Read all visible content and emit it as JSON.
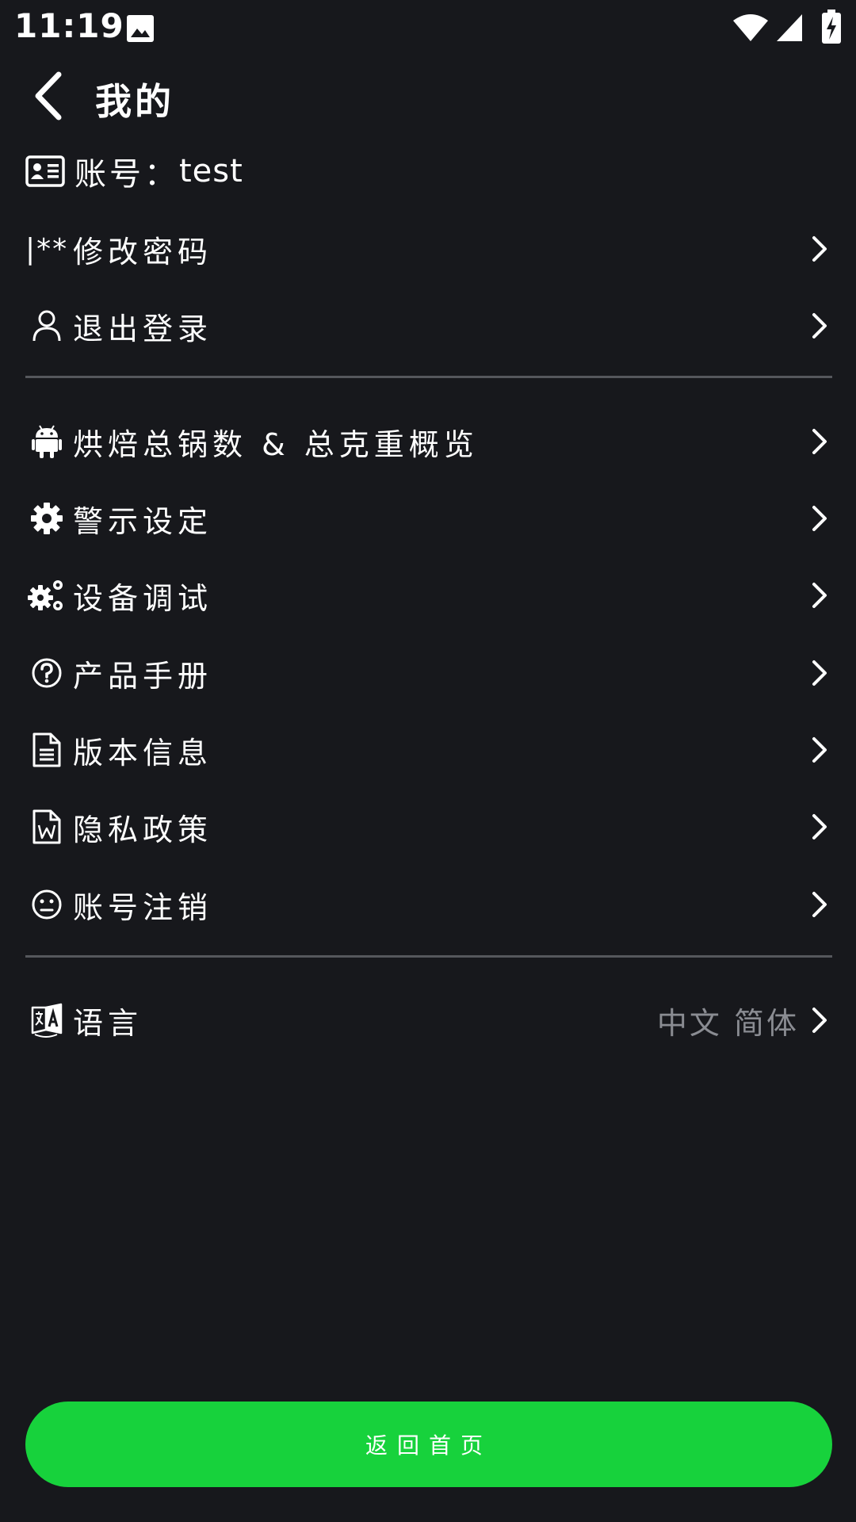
{
  "status_bar": {
    "time": "11:19"
  },
  "header": {
    "title": "我的"
  },
  "account": {
    "label": "账号：",
    "value": "test"
  },
  "account_menu": [
    {
      "label": "修改密码"
    },
    {
      "label": "退出登录"
    }
  ],
  "main_menu": [
    {
      "label": "烘焙总锅数 & 总克重概览"
    },
    {
      "label": "警示设定"
    },
    {
      "label": "设备调试"
    },
    {
      "label": "产品手册"
    },
    {
      "label": "版本信息"
    },
    {
      "label": "隐私政策"
    },
    {
      "label": "账号注销"
    }
  ],
  "language": {
    "label": "语言",
    "value": "中文 简体"
  },
  "password_icon_text": "|**",
  "home_button": {
    "label": "返回首页"
  },
  "colors": {
    "background": "#17181c",
    "accent": "#17d23c",
    "divider": "#55575c",
    "muted_text": "#8a8c92"
  }
}
